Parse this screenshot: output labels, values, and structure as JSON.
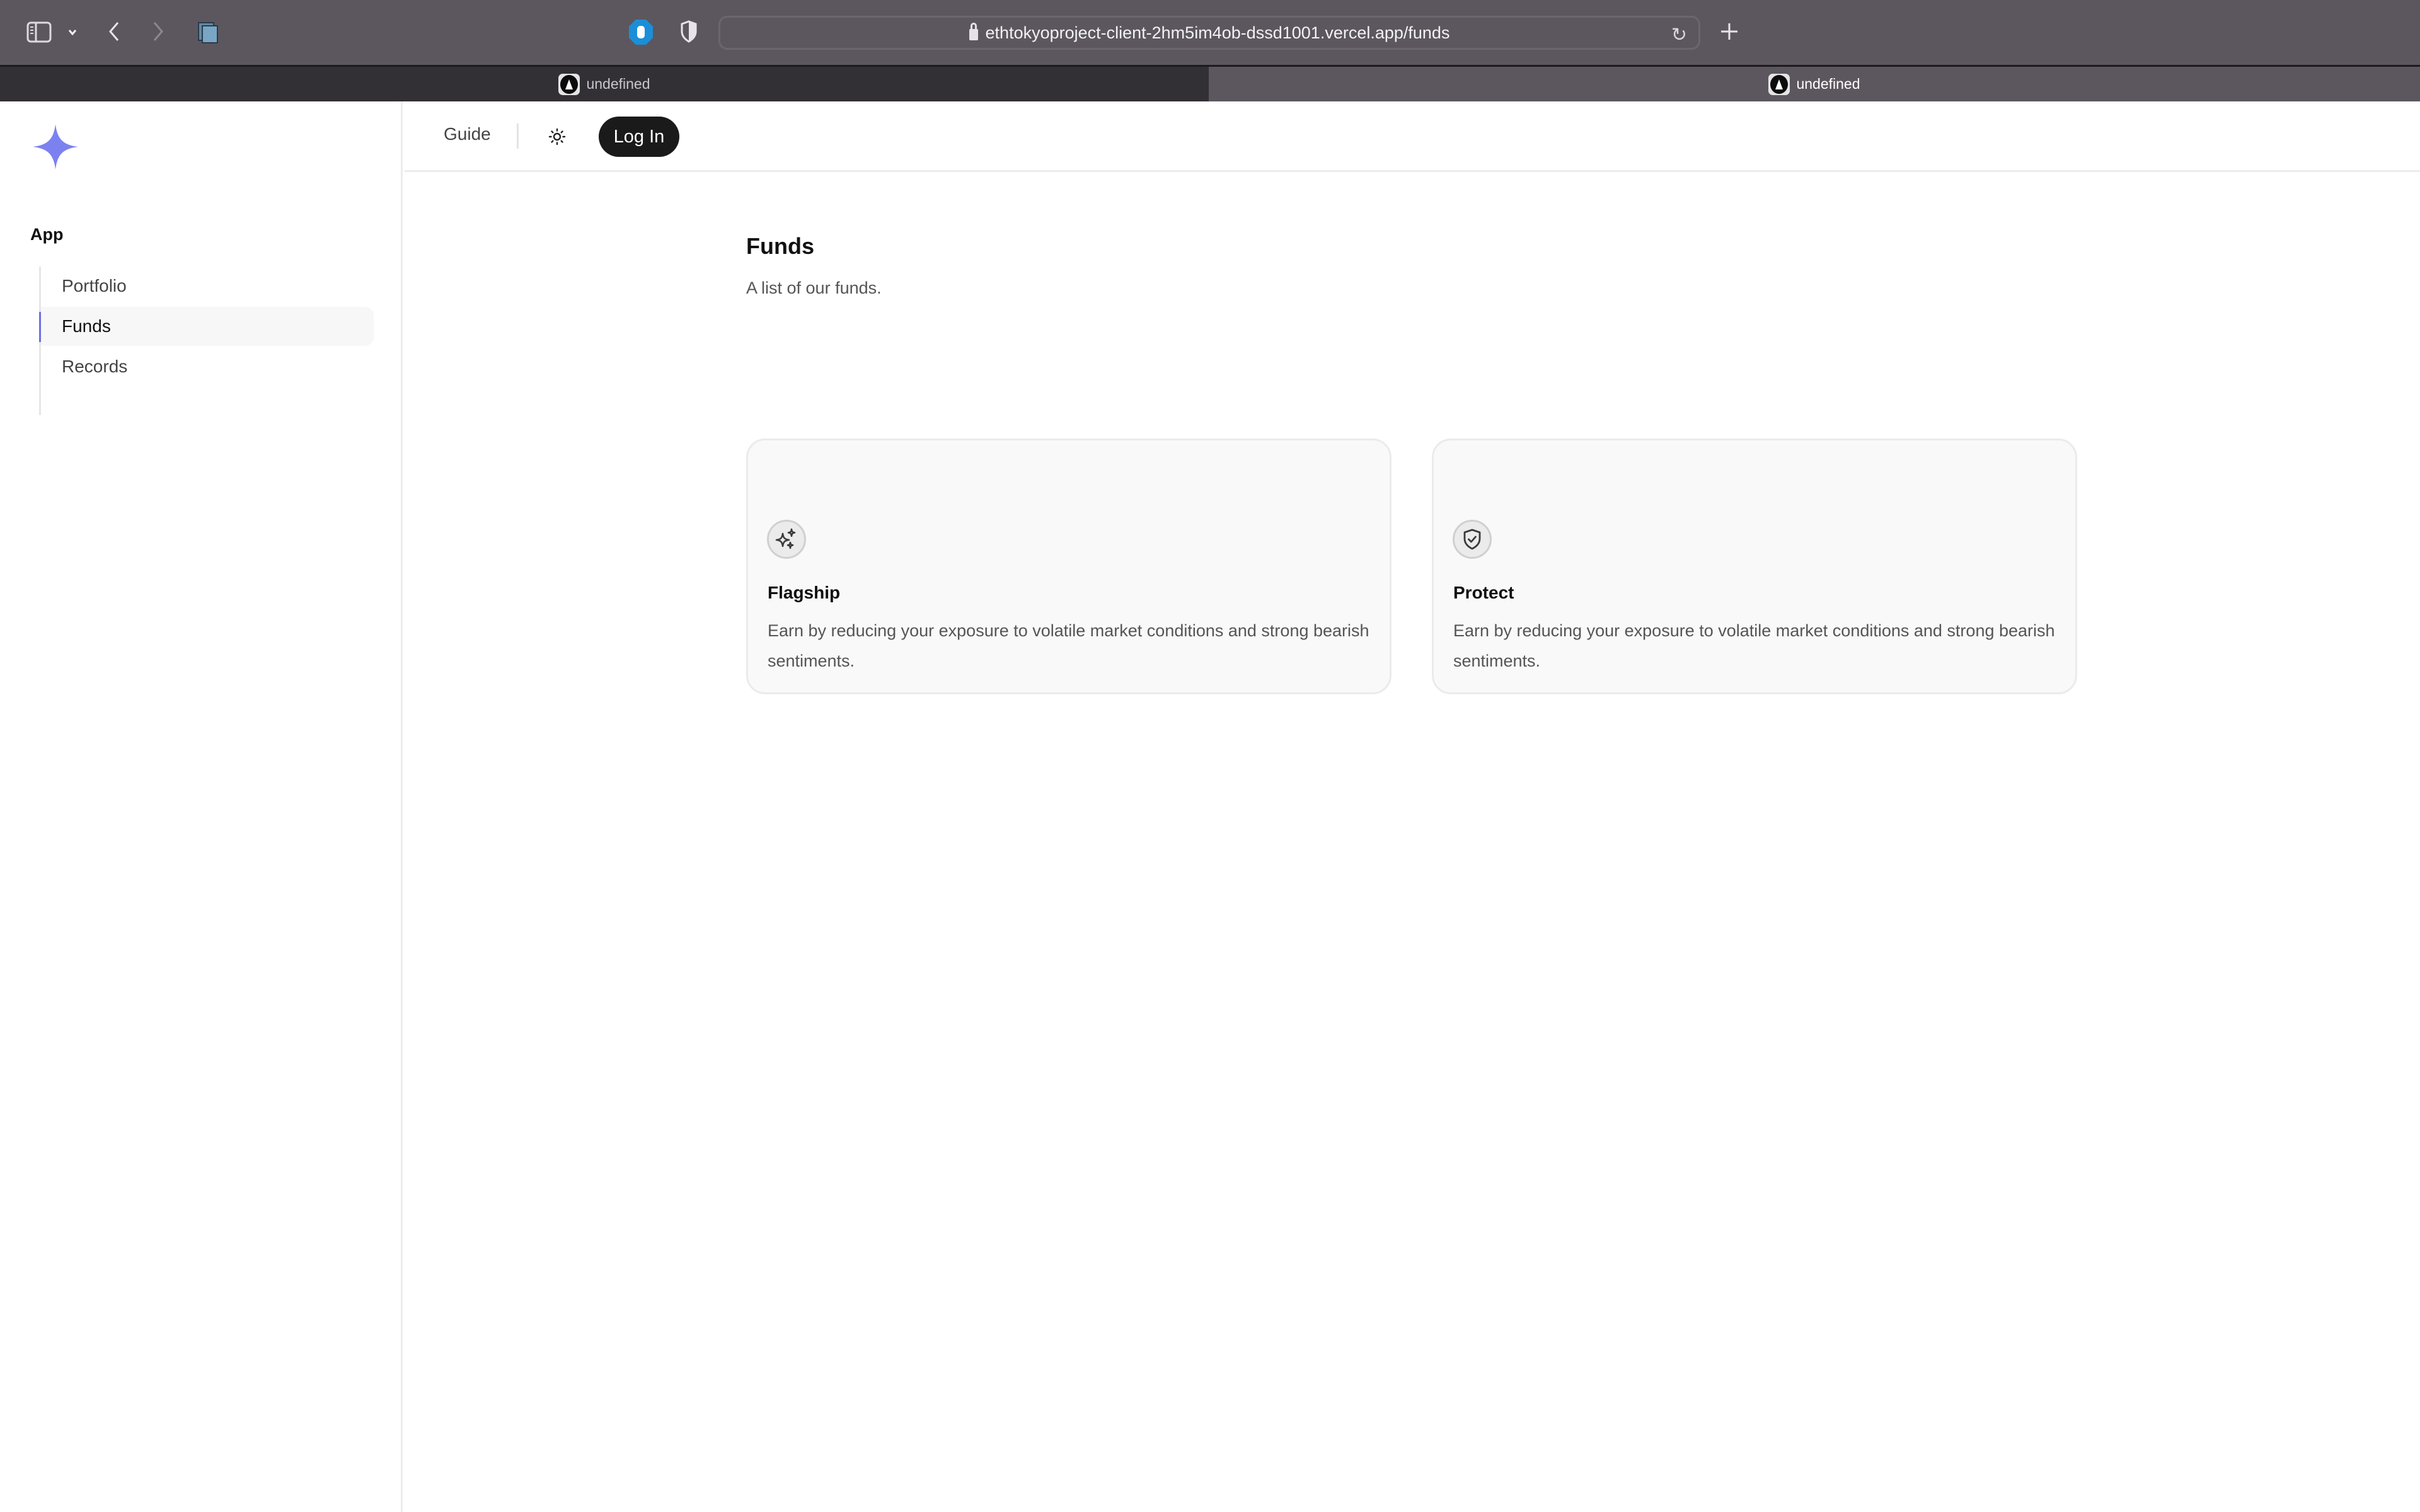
{
  "browser": {
    "url": "ethtokyoproject-client-2hm5im4ob-dssd1001.vercel.app/funds",
    "tabs": [
      {
        "title": "undefined",
        "active": false
      },
      {
        "title": "undefined",
        "active": true
      }
    ],
    "icons": [
      "sidebar-toggle-icon",
      "chevron-down-icon",
      "back-icon",
      "forward-icon",
      "tab-overview-icon",
      "adblock-icon",
      "privacy-shield-icon",
      "lock-icon",
      "reload-icon",
      "new-tab-icon"
    ]
  },
  "sidebar": {
    "logo": "sparkle-logo",
    "accent_color": "#7b82f0",
    "heading": "App",
    "items": [
      {
        "label": "Portfolio",
        "active": false
      },
      {
        "label": "Funds",
        "active": true
      },
      {
        "label": "Records",
        "active": false
      }
    ]
  },
  "header": {
    "guide_label": "Guide",
    "theme_icon": "sun-icon",
    "login_label": "Log In"
  },
  "main": {
    "title": "Funds",
    "subtitle": "A list of our funds.",
    "funds": [
      {
        "icon": "sparkles-icon",
        "name": "Flagship",
        "description": "Earn by reducing your exposure to volatile market conditions and strong bearish sentiments."
      },
      {
        "icon": "shield-check-icon",
        "name": "Protect",
        "description": "Earn by reducing your exposure to volatile market conditions and strong bearish sentiments."
      }
    ]
  }
}
